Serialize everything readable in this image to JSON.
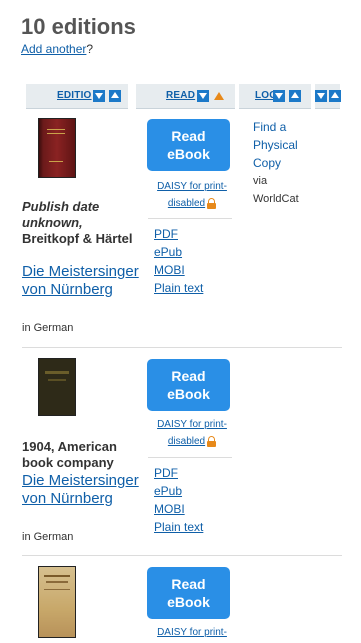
{
  "heading": "10 editions",
  "add_link": "Add another",
  "add_suffix": "?",
  "columns": {
    "edition": "EDITIO",
    "read": "READ",
    "locate": "LOC"
  },
  "rows": [
    {
      "publish": "Publish date unknown,",
      "publisher": "Breitkopf & Härtel",
      "title": "Die Meistersinger von Nürnberg",
      "lang": "in German",
      "read_label": "Read eBook",
      "daisy_line1": "DAISY for print-",
      "daisy_line2": "disabled",
      "formats": [
        "PDF",
        "ePub",
        "MOBI",
        "Plain text"
      ],
      "locate": [
        "Find a",
        "Physical",
        "Copy"
      ],
      "via": "via",
      "via_source": "WorldCat"
    },
    {
      "publish": "1904, American book company",
      "title": "Die Meistersinger von Nürnberg",
      "lang": "in German",
      "read_label": "Read eBook",
      "daisy_line1": "DAISY for print-",
      "daisy_line2": "disabled",
      "formats": [
        "PDF",
        "ePub",
        "MOBI",
        "Plain text"
      ]
    },
    {
      "read_label": "Read eBook",
      "daisy_line1": "DAISY for print-"
    }
  ],
  "colors": {
    "link": "#0f5fa8",
    "button": "#2a8fe6",
    "accent": "#e7891a"
  }
}
